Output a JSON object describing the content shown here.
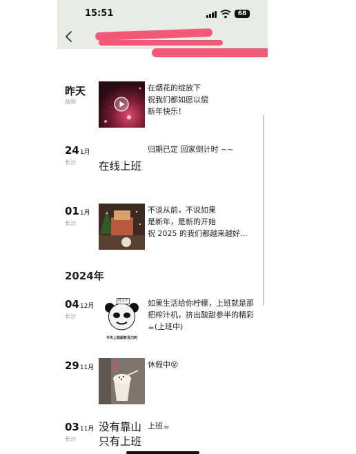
{
  "status": {
    "time": "15:51",
    "battery": "68"
  },
  "nav": {
    "back_icon": "chevron-left-icon"
  },
  "timeline": [
    {
      "day": "昨天",
      "month": "",
      "location": "益阳",
      "text": "在烟花的绽放下\n祝我们都如愿以偿\n新年快乐！",
      "media": "video",
      "media_icon": "play-icon"
    },
    {
      "day": "24",
      "month": "1月",
      "location": "长沙",
      "text": "归期已定  回家倒计时 ~~",
      "big_text": "在线上班"
    },
    {
      "day": "01",
      "month": "1月",
      "location": "长沙",
      "text": "不谈从前，不说如果\n是新年，是新的开始\n祝 2025 的我们都越来越好...",
      "media": "photo"
    }
  ],
  "year_header": "2024年",
  "timeline_2024": [
    {
      "day": "04",
      "month": "12月",
      "location": "长沙",
      "text": "如果生活给你柠檬，上班就是那把榨汁机，挤出酸甜参半的精彩☕(上班中)",
      "media": "meme",
      "meme_badge": "打工人",
      "meme_caption": "今天上班超有活力的"
    },
    {
      "day": "29",
      "month": "11月",
      "location": "",
      "text": "休假中😵",
      "media": "photo"
    },
    {
      "day": "03",
      "month": "11月",
      "location": "长沙",
      "text": "上班☕",
      "big_text": "没有靠山\n只有上班"
    }
  ],
  "colors": {
    "redaction": "#f05a76",
    "topbar": "#e9ebe6"
  }
}
